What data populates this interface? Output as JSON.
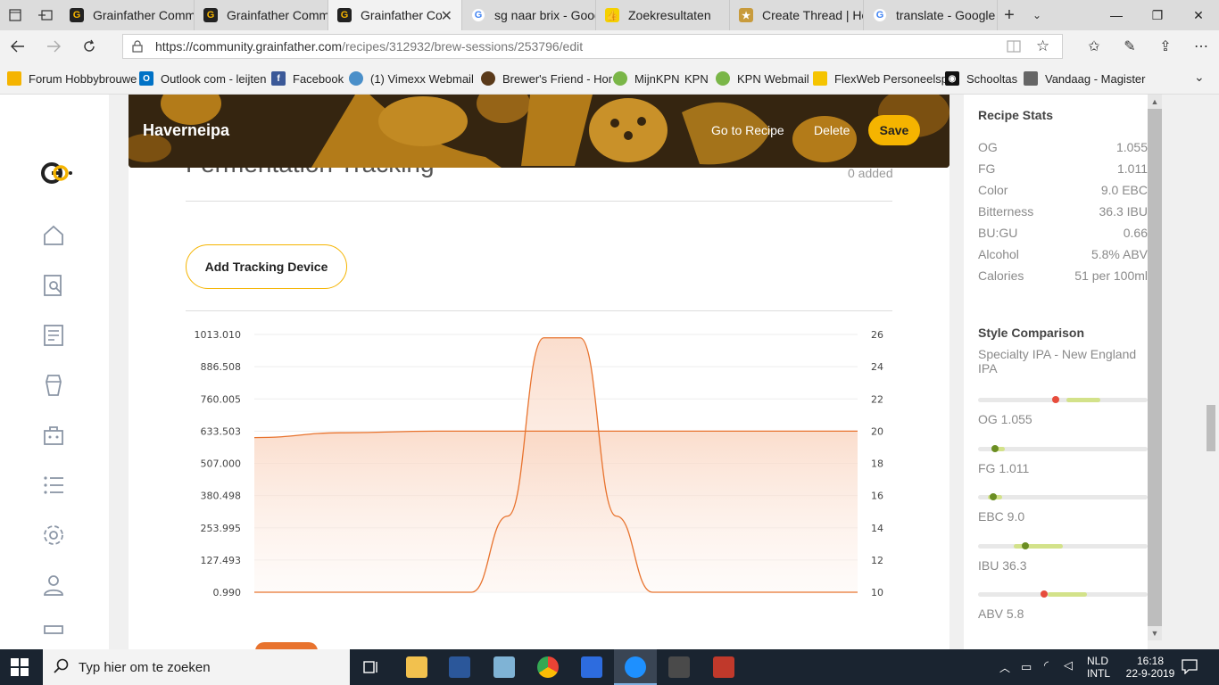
{
  "browser": {
    "tabs": [
      {
        "label": "Grainfather Comm",
        "icon": "grainfather-icon"
      },
      {
        "label": "Grainfather Comm",
        "icon": "grainfather-icon"
      },
      {
        "label": "Grainfather Co",
        "icon": "grainfather-icon",
        "active": true
      },
      {
        "label": "sg naar brix - Goog",
        "icon": "google-icon"
      },
      {
        "label": "Zoekresultaten",
        "icon": "thumbs-icon"
      },
      {
        "label": "Create Thread | Ho",
        "icon": "forum-icon"
      },
      {
        "label": "translate - Google",
        "icon": "google-icon"
      }
    ],
    "url_host": "https://community.grainfather.com",
    "url_path": "/recipes/312932/brew-sessions/253796/edit",
    "favorites": [
      "Forum Hobbybrouwe",
      "Outlook com - leijten",
      "Facebook",
      "(1) Vimexx Webmail",
      "Brewer's Friend - Hor",
      "MijnKPN",
      "KPN",
      "KPN Webmail",
      "FlexWeb Personeelsp",
      "Schooltas",
      "Vandaag - Magister"
    ]
  },
  "header": {
    "recipe_name": "Haverneipa",
    "go_to_recipe": "Go to Recipe",
    "delete": "Delete",
    "save": "Save"
  },
  "section": {
    "title": "Fermentation Tracking",
    "added": "0 added",
    "add_device": "Add Tracking Device"
  },
  "chart_data": {
    "type": "area",
    "left_ticks": [
      "1013.010",
      "886.508",
      "760.005",
      "633.503",
      "507.000",
      "380.498",
      "253.995",
      "127.493",
      "0.990"
    ],
    "right_ticks": [
      "26",
      "24",
      "22",
      "20",
      "18",
      "16",
      "14",
      "12",
      "10"
    ],
    "left_ylim": [
      0.99,
      1013.01
    ],
    "right_ylim": [
      10,
      26
    ],
    "series": [
      {
        "axis": "left",
        "x": [
          0,
          0.36,
          0.42,
          0.48,
          0.54,
          0.6,
          0.66,
          1
        ],
        "values": [
          0.99,
          0.99,
          300,
          1000,
          1000,
          300,
          0.99,
          0.99
        ]
      },
      {
        "axis": "right",
        "x": [
          0,
          0.15,
          0.3,
          1
        ],
        "values": [
          19.6,
          19.9,
          20.0,
          20.0
        ]
      }
    ],
    "colors": {
      "line": "#e8732e",
      "fill": "#fbe0d0"
    }
  },
  "stats": {
    "title": "Recipe Stats",
    "rows": [
      {
        "label": "OG",
        "value": "1.055"
      },
      {
        "label": "FG",
        "value": "1.011"
      },
      {
        "label": "Color",
        "value": "9.0 EBC"
      },
      {
        "label": "Bitterness",
        "value": "36.3 IBU"
      },
      {
        "label": "BU:GU",
        "value": "0.66"
      },
      {
        "label": "Alcohol",
        "value": "5.8% ABV"
      },
      {
        "label": "Calories",
        "value": "51 per 100ml"
      }
    ]
  },
  "style": {
    "title": "Style Comparison",
    "name": "Specialty IPA - New England IPA",
    "ranges": [
      {
        "label": "OG 1.055",
        "band": [
          0.52,
          0.72
        ],
        "dot": 0.46,
        "dot_color": "#e74c3c"
      },
      {
        "label": "FG 1.011",
        "band": [
          0.08,
          0.16
        ],
        "dot": 0.1,
        "dot_color": "#6b8e23"
      },
      {
        "label": "EBC 9.0",
        "band": [
          0.06,
          0.14
        ],
        "dot": 0.09,
        "dot_color": "#6b8e23"
      },
      {
        "label": "IBU 36.3",
        "band": [
          0.21,
          0.5
        ],
        "dot": 0.28,
        "dot_color": "#6b8e23"
      },
      {
        "label": "ABV 5.8",
        "band": [
          0.41,
          0.64
        ],
        "dot": 0.39,
        "dot_color": "#e74c3c"
      }
    ]
  },
  "taskbar": {
    "search_placeholder": "Typ hier om te zoeken",
    "lang1": "NLD",
    "lang2": "INTL",
    "time": "16:18",
    "date": "22-9-2019"
  },
  "colors": {
    "accent": "#f5b400",
    "hero": "#3b2a12"
  }
}
